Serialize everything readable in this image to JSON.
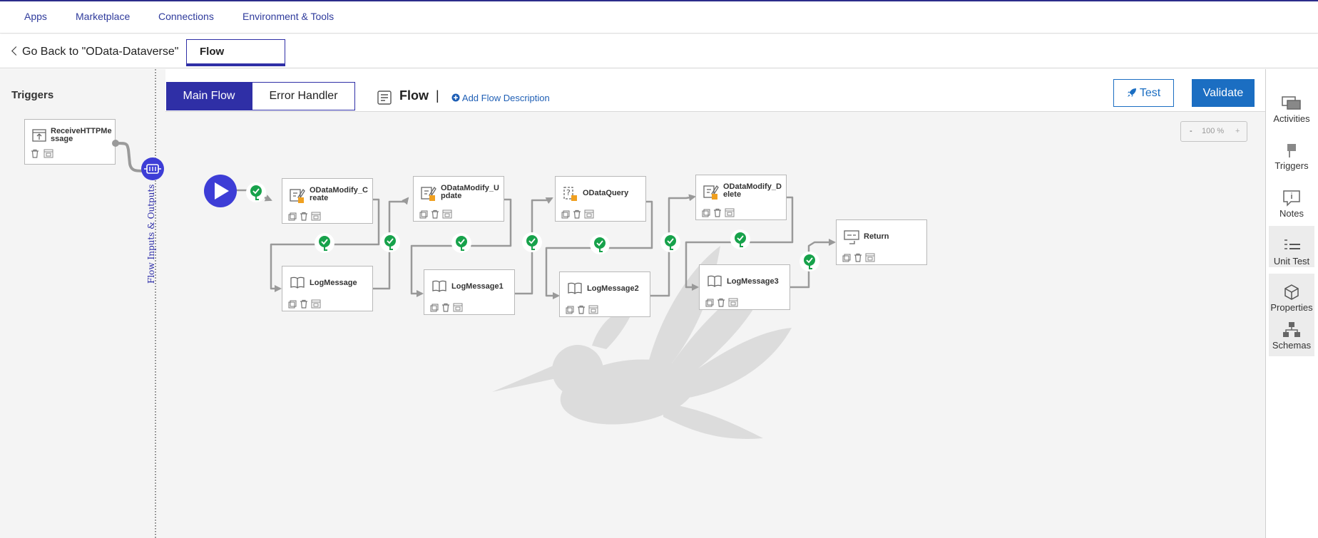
{
  "topnav": {
    "apps": "Apps",
    "marketplace": "Marketplace",
    "connections": "Connections",
    "environment": "Environment & Tools"
  },
  "subbar": {
    "back": "Go Back to \"OData-Dataverse\"",
    "flow_tab": "Flow"
  },
  "triggers": {
    "title": "Triggers",
    "card": "ReceiveHTTPMessage",
    "io_label": "Flow Inputs & Outputs"
  },
  "header": {
    "main_flow": "Main Flow",
    "error_handler": "Error Handler",
    "flow_title": "Flow",
    "separator": "|",
    "add_description": "Add Flow Description",
    "test": "Test",
    "validate": "Validate"
  },
  "zoom": {
    "minus": "-",
    "level": "100 %",
    "plus": "+"
  },
  "activities": {
    "create": "ODataModify_Create",
    "update": "ODataModify_Update",
    "query": "ODataQuery",
    "delete": "ODataModify_Delete",
    "log": "LogMessage",
    "log1": "LogMessage1",
    "log2": "LogMessage2",
    "log3": "LogMessage3",
    "return": "Return"
  },
  "rightbar": {
    "activities": "Activities",
    "triggers": "Triggers",
    "notes": "Notes",
    "unit_test": "Unit Test",
    "properties": "Properties",
    "schemas": "Schemas"
  },
  "colors": {
    "brand": "#2f2fa6",
    "accent": "#1b6ec2",
    "success": "#17a24b",
    "canvas": "#f4f4f4"
  }
}
